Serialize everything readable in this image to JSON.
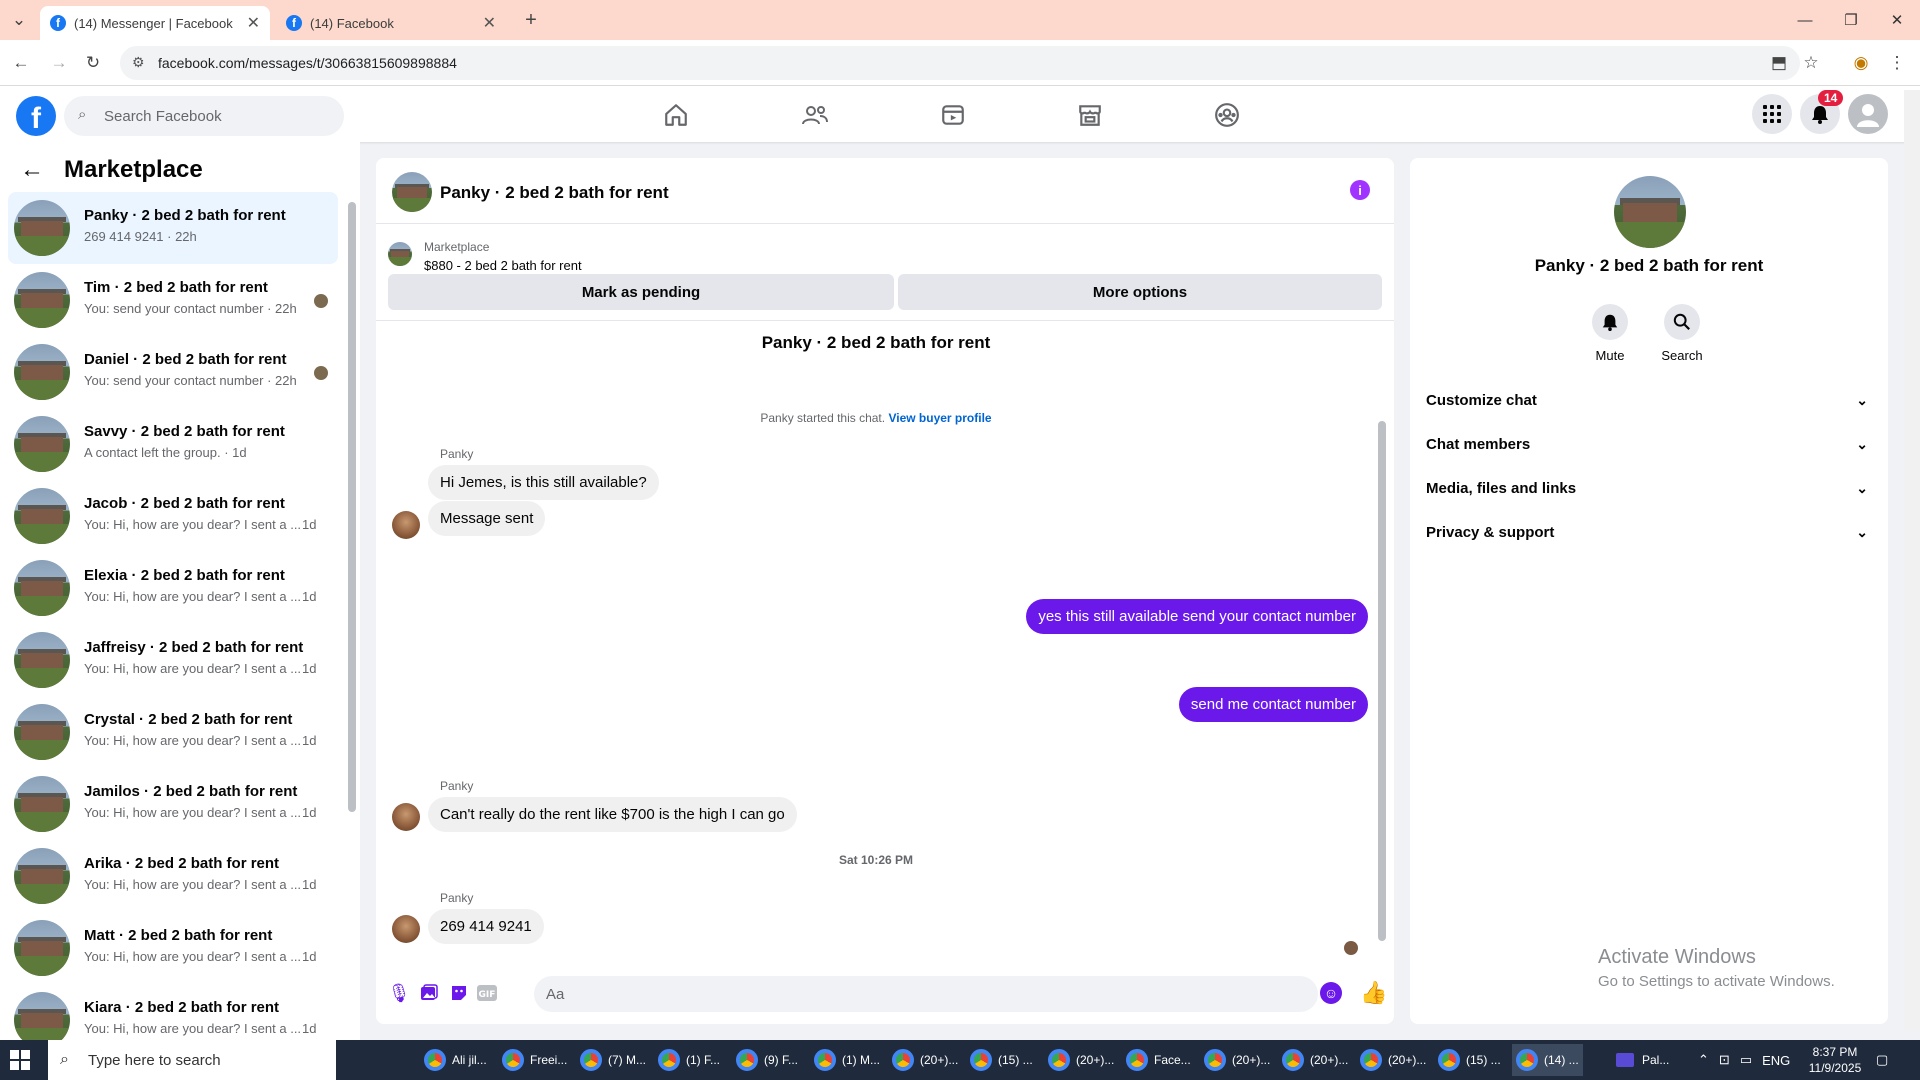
{
  "browser": {
    "tabs": [
      {
        "label": "(14) Messenger | Facebook",
        "active": true
      },
      {
        "label": "(14) Facebook",
        "active": false
      }
    ],
    "url": "facebook.com/messages/t/30663815609898884"
  },
  "fb_header": {
    "search_placeholder": "Search Facebook",
    "notification_count": "14"
  },
  "sidebar": {
    "title": "Marketplace",
    "conversations": [
      {
        "title": "Panky · 2 bed 2 bath for rent",
        "preview": "269 414 9241 · 22h",
        "age": "",
        "selected": true
      },
      {
        "title": "Tim · 2 bed 2 bath for rent",
        "preview": "You: send your contact number · 22h",
        "age": ""
      },
      {
        "title": "Daniel · 2 bed 2 bath for rent",
        "preview": "You: send your contact number · 22h",
        "age": ""
      },
      {
        "title": "Savvy · 2 bed 2 bath for rent",
        "preview": "A contact left the group. · 1d",
        "age": ""
      },
      {
        "title": "Jacob · 2 bed 2 bath for rent",
        "preview": "You: Hi, how are you dear? I sent a ...",
        "age": "1d"
      },
      {
        "title": "Elexia · 2 bed 2 bath for rent",
        "preview": "You: Hi, how are you dear? I sent a ...",
        "age": "1d"
      },
      {
        "title": "Jaffreisy · 2 bed 2 bath for rent",
        "preview": "You: Hi, how are you dear? I sent a ...",
        "age": "1d"
      },
      {
        "title": "Crystal · 2 bed 2 bath for rent",
        "preview": "You: Hi, how are you dear? I sent a ...",
        "age": "1d"
      },
      {
        "title": "Jamilos · 2 bed 2 bath for rent",
        "preview": "You: Hi, how are you dear? I sent a ...",
        "age": "1d"
      },
      {
        "title": "Arika · 2 bed 2 bath for rent",
        "preview": "You: Hi, how are you dear? I sent a ...",
        "age": "1d"
      },
      {
        "title": "Matt · 2 bed 2 bath for rent",
        "preview": "You: Hi, how are you dear? I sent a ...",
        "age": "1d"
      },
      {
        "title": "Kiara · 2 bed 2 bath for rent",
        "preview": "You: Hi, how are you dear? I sent a ...",
        "age": "1d"
      }
    ]
  },
  "chat": {
    "header_name": "Panky · 2 bed 2 bath for rent",
    "marketplace_label": "Marketplace",
    "listing": "$880 - 2 bed 2 bath for rent",
    "mark_pending": "Mark as pending",
    "more_options": "More options",
    "conversation_title": "Panky · 2 bed 2 bath for rent",
    "started_text": "Panky started this chat.",
    "view_profile": "View buyer profile",
    "sender": "Panky",
    "msg1": "Hi Jemes, is this still available?",
    "msg2": "Message sent",
    "out1": "yes this still available send your contact number",
    "out2": "send me contact number",
    "msg3": "Can't really do the rent like $700 is the high I can go",
    "timestamp": "Sat 10:26 PM",
    "msg4": "269 414 9241",
    "composer_placeholder": "Aa"
  },
  "right_panel": {
    "name": "Panky · 2 bed 2 bath for rent",
    "mute_label": "Mute",
    "search_label": "Search",
    "sections": [
      "Customize chat",
      "Chat members",
      "Media, files and links",
      "Privacy & support"
    ]
  },
  "watermark": {
    "line1": "Activate Windows",
    "line2": "Go to Settings to activate Windows."
  },
  "taskbar": {
    "search_placeholder": "Type here to search",
    "items": [
      "Ali jil...",
      "Freei...",
      "(7) M...",
      "(1) F...",
      "(9) F...",
      "(1) M...",
      "(20+)...",
      "(15) ...",
      "(20+)...",
      "Face...",
      "(20+)...",
      "(20+)...",
      "(20+)...",
      "(15) ...",
      "(14) ..."
    ],
    "pal_label": "Pal...",
    "lang": "ENG",
    "time": "8:37 PM",
    "date": "11/9/2025"
  },
  "colors": {
    "messenger_purple": "#6a19ea",
    "facebook_blue": "#1877f2",
    "tab_bar": "#fcd9cc"
  }
}
